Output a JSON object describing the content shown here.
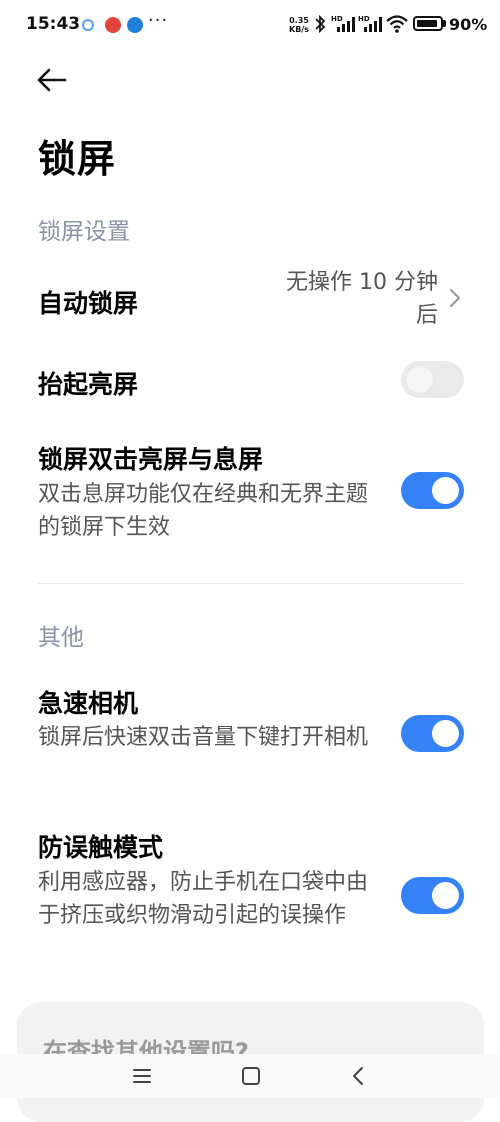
{
  "status_bar": {
    "time": "15:43",
    "more": "···",
    "net_speed_value": "0.35",
    "net_speed_unit": "KB/s",
    "battery_text": "90%",
    "battery_level": 0.9,
    "notif_colors": [
      "#5aa0e6",
      "#e0443a",
      "#1d7fd6"
    ]
  },
  "header": {
    "title": "锁屏"
  },
  "sections": {
    "lock_settings_label": "锁屏设置",
    "other_label": "其他"
  },
  "rows": {
    "auto_lock": {
      "title": "自动锁屏",
      "value": "无操作 10 分钟后"
    },
    "raise_to_wake": {
      "title": "抬起亮屏",
      "enabled": false
    },
    "double_tap": {
      "title": "锁屏双击亮屏与息屏",
      "subtitle": "双击息屏功能仅在经典和无界主题的锁屏下生效",
      "enabled": true
    },
    "quick_camera": {
      "title": "急速相机",
      "subtitle": "锁屏后快速双击音量下键打开相机",
      "enabled": true
    },
    "pocket_mode": {
      "title": "防误触模式",
      "subtitle": "利用感应器，防止手机在口袋中由于挤压或织物滑动引起的误操作",
      "enabled": true
    }
  },
  "suggestion_card": {
    "text": "在查找其他设置吗?"
  },
  "colors": {
    "accent": "#3482f6",
    "section_label": "#8a93a6"
  }
}
